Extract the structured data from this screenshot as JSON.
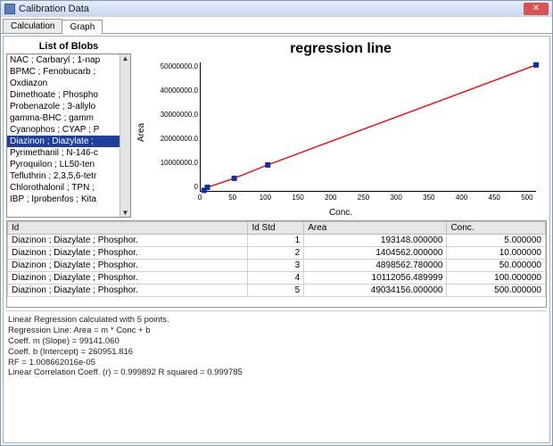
{
  "window": {
    "title": "Calibration Data"
  },
  "tabs": [
    {
      "label": "Calculation"
    },
    {
      "label": "Graph"
    }
  ],
  "blobs": {
    "title": "List of Blobs",
    "items": [
      "NAC ; Carbaryl ; 1-nap",
      "BPMC ; Fenobucarb ;",
      "Oxdiazon",
      "Dimethoate ; Phospho",
      "Probenazole ; 3-allylo",
      "gamma-BHC ; gamm",
      "Cyanophos ; CYAP ; P",
      "Diazinon ; Diazylate ;",
      "Pyrimethanil ; N-146-c",
      "Pyroquilon ; LL50-ten",
      "Tefluthrin ; 2,3,5,6-tetr",
      "Chlorothalonil ; TPN ;",
      "IBP ; Iprobenfos ; Kita"
    ],
    "selected_index": 7
  },
  "chart": {
    "title": "regression line",
    "xlabel": "Conc.",
    "ylabel": "Area"
  },
  "chart_data": {
    "type": "line",
    "title": "regression line",
    "xlabel": "Conc.",
    "ylabel": "Area",
    "xlim": [
      0,
      500
    ],
    "ylim": [
      0,
      50000000
    ],
    "x_ticks": [
      0,
      50,
      100,
      150,
      200,
      250,
      300,
      350,
      400,
      450,
      500
    ],
    "y_ticks": [
      "50000000.0",
      "40000000.0",
      "30000000.0",
      "20000000.0",
      "10000000.0",
      "0"
    ],
    "series": [
      {
        "name": "Diazinon ; Diazylate ; Phosphor.",
        "x": [
          5,
          10,
          50,
          100,
          500
        ],
        "y": [
          193148.0,
          1404562.0,
          4898562.78,
          10112056.48999,
          49034156.0
        ]
      }
    ]
  },
  "table": {
    "headers": [
      "Id",
      "Id Std",
      "Area",
      "Conc."
    ],
    "rows": [
      [
        "Diazinon ; Diazylate ; Phosphor.",
        "1",
        "193148.000000",
        "5.000000"
      ],
      [
        "Diazinon ; Diazylate ; Phosphor.",
        "2",
        "1404562.000000",
        "10.000000"
      ],
      [
        "Diazinon ; Diazylate ; Phosphor.",
        "3",
        "4898562.780000",
        "50.000000"
      ],
      [
        "Diazinon ; Diazylate ; Phosphor.",
        "4",
        "10112056.489999",
        "100.000000"
      ],
      [
        "Diazinon ; Diazylate ; Phosphor.",
        "5",
        "49034156.000000",
        "500.000000"
      ]
    ]
  },
  "footer": {
    "lines": [
      "Linear Regression calculated with 5 points.",
      "Regression Line: Area = m * Conc + b",
      "Coeff. m (Slope) = 99141.060",
      "Coeff. b (Intercept) = 260951.816",
      "RF = 1.008662016e-05",
      "Linear Correlation Coeff. (r) = 0.999892  R squared = 0.999785"
    ]
  }
}
